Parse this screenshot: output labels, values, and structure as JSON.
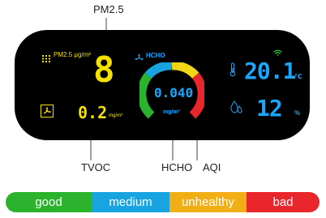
{
  "labels": {
    "pm25": "PM2.5",
    "tvoc": "TVOC",
    "hcho": "HCHO",
    "aqi": "AQI"
  },
  "display": {
    "pm25_title": "PM2.5 μg/m³",
    "pm25_value": "8",
    "tvoc_value": "0.2",
    "tvoc_unit": "mg/m³",
    "hcho_title": "HCHO",
    "hcho_value": "0.040",
    "hcho_unit": "mg/m³",
    "temperature_value": "20.1",
    "temperature_unit": "℃",
    "humidity_value": "12",
    "humidity_unit": "%"
  },
  "scale": [
    {
      "label": "good",
      "color": "#2bb32d"
    },
    {
      "label": "medium",
      "color": "#18a4e0"
    },
    {
      "label": "unhealthy",
      "color": "#f2ae15"
    },
    {
      "label": "bad",
      "color": "#e8262b"
    }
  ],
  "colors": {
    "panel": "#000000",
    "segment_yellow": "#f5e100",
    "segment_cyan": "#1aa6ff",
    "wifi": "#2ecc40"
  },
  "icons": {
    "fan": "fan-icon",
    "wifi": "wifi-icon",
    "thermometer": "thermometer-icon",
    "humidity": "droplet-icon",
    "grid": "grid-icon"
  }
}
